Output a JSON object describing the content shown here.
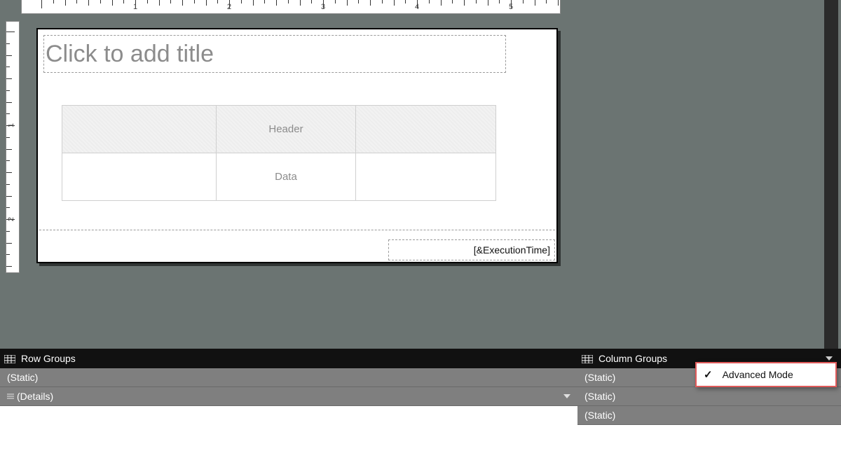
{
  "rulers": {
    "h_labels": [
      "1",
      "2",
      "3",
      "4",
      "5"
    ],
    "v_labels": [
      "1",
      "2"
    ]
  },
  "report": {
    "title_placeholder": "Click to add title",
    "tablix": {
      "header_row": [
        "",
        "Header",
        ""
      ],
      "data_row": [
        "",
        "Data",
        ""
      ]
    },
    "footer_expr": "[&ExecutionTime]"
  },
  "row_groups": {
    "title": "Row Groups",
    "items": [
      "(Static)",
      "(Details)"
    ]
  },
  "column_groups": {
    "title": "Column Groups",
    "items": [
      "(Static)",
      "(Static)",
      "(Static)"
    ]
  },
  "popup": {
    "item": "Advanced Mode",
    "checked": true
  }
}
